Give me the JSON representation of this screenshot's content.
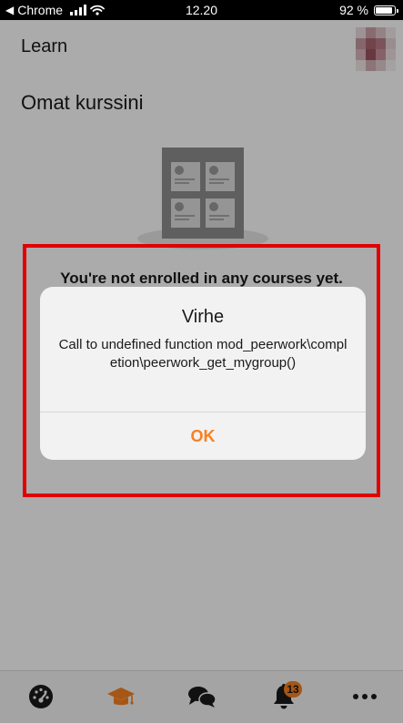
{
  "status_bar": {
    "back_app": "Chrome",
    "time": "12.20",
    "battery_text": "92 %",
    "battery_level": 0.92
  },
  "header": {
    "title": "Learn"
  },
  "main": {
    "page_title": "Omat kurssini",
    "empty_message": "You're not enrolled in any courses yet."
  },
  "alert": {
    "title": "Virhe",
    "message": "Call to undefined function mod_peerwork\\completion\\peerwork_get_mygroup()",
    "ok_label": "OK"
  },
  "tab_bar": {
    "items": [
      {
        "icon": "dashboard-icon"
      },
      {
        "icon": "graduation-cap-icon",
        "active": true
      },
      {
        "icon": "chat-bubbles-icon"
      },
      {
        "icon": "bell-icon",
        "badge": "13"
      },
      {
        "icon": "more-icon"
      }
    ]
  },
  "colors": {
    "accent": "#f88020",
    "highlight": "#e00000"
  }
}
